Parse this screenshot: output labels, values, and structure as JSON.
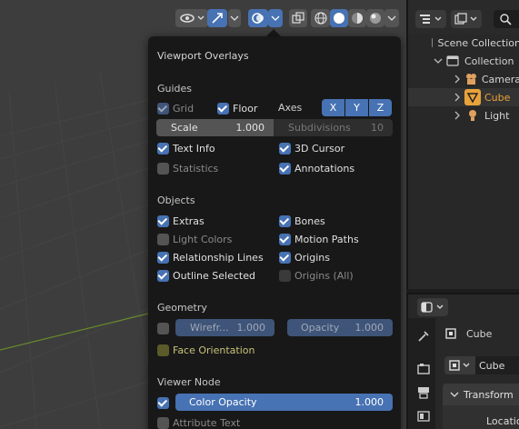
{
  "header": {
    "icons": [
      "visibility-icon",
      "gizmo-icon",
      "overlays-icon",
      "xray-icon",
      "wireframe-shading-icon",
      "solid-shading-icon",
      "material-shading-icon",
      "rendered-shading-icon"
    ]
  },
  "overlays": {
    "title": "Viewport Overlays",
    "guides": {
      "title": "Guides",
      "grid": "Grid",
      "floor": "Floor",
      "axes_label": "Axes",
      "axes": [
        "X",
        "Y",
        "Z"
      ],
      "scale_label": "Scale",
      "scale_value": "1.000",
      "subdiv_label": "Subdivisions",
      "subdiv_value": "10",
      "text_info": "Text Info",
      "cursor_3d": "3D Cursor",
      "statistics": "Statistics",
      "annotations": "Annotations"
    },
    "objects": {
      "title": "Objects",
      "extras": "Extras",
      "bones": "Bones",
      "light_colors": "Light Colors",
      "motion_paths": "Motion Paths",
      "relationship_lines": "Relationship Lines",
      "origins": "Origins",
      "outline_selected": "Outline Selected",
      "origins_all": "Origins (All)"
    },
    "geometry": {
      "title": "Geometry",
      "wireframe_label": "Wirefr...",
      "wireframe_value": "1.000",
      "opacity_label": "Opacity",
      "opacity_value": "1.000",
      "face_orientation": "Face Orientation"
    },
    "viewer_node": {
      "title": "Viewer Node",
      "color_opacity_label": "Color Opacity",
      "color_opacity_value": "1.000",
      "attribute_text": "Attribute Text"
    }
  },
  "outliner": {
    "scene_collection": "Scene Collection",
    "collection": "Collection",
    "items": [
      {
        "label": "Camera",
        "icon": "camera-icon",
        "color": "#e0a060"
      },
      {
        "label": "Cube",
        "icon": "mesh-icon",
        "color": "#e8a33a"
      },
      {
        "label": "Light",
        "icon": "light-icon",
        "color": "#e0a060"
      }
    ]
  },
  "properties": {
    "object_name": "Cube",
    "data_name": "Cube",
    "transform_label": "Transform",
    "location_label": "Location"
  },
  "colors": {
    "accent": "#4772b3",
    "highlight": "#4a4a17",
    "selected_text": "#e8a33a"
  }
}
